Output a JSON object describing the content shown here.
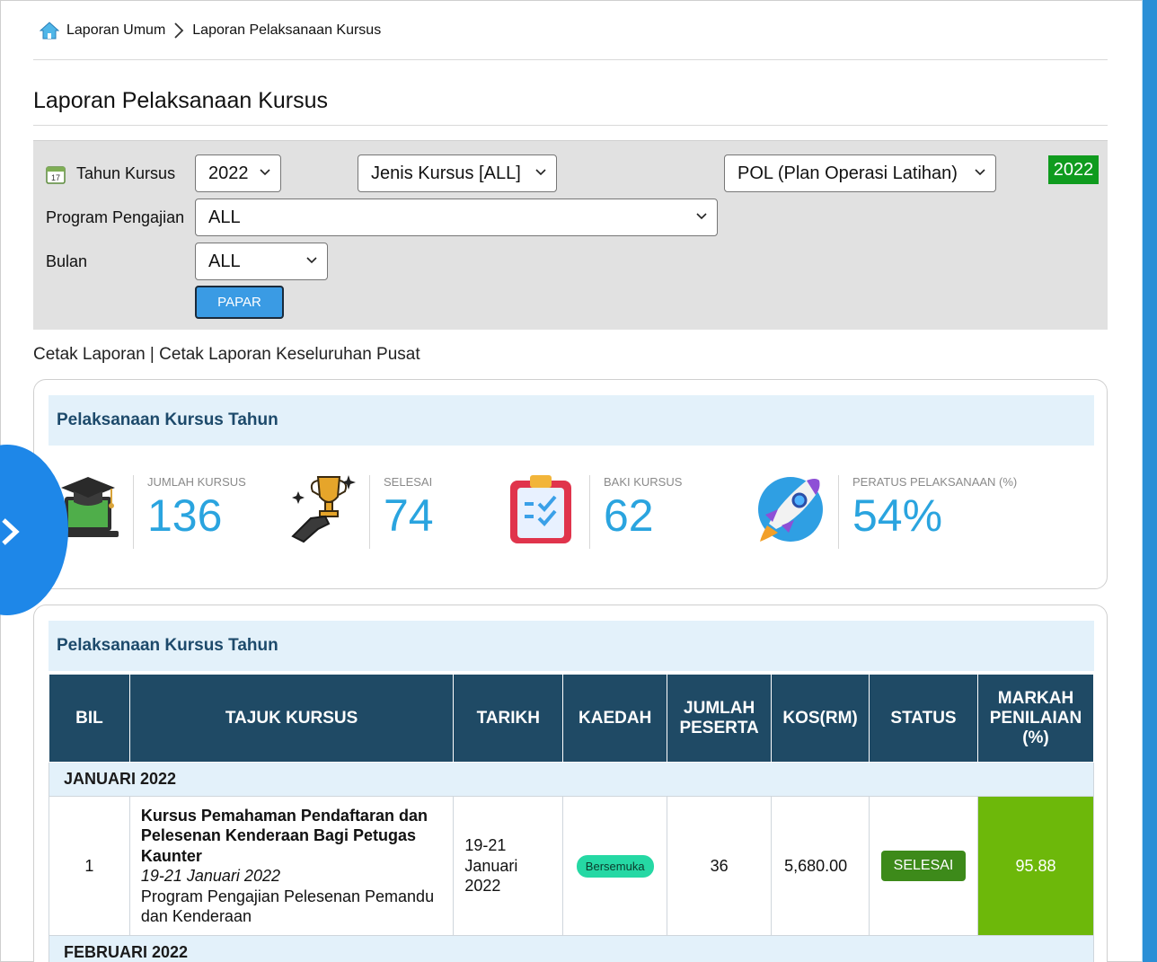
{
  "breadcrumb": {
    "home": "Laporan Umum",
    "current": "Laporan Pelaksanaan Kursus"
  },
  "page": {
    "title": "Laporan Pelaksanaan Kursus"
  },
  "filters": {
    "tahun_label": "Tahun Kursus",
    "tahun_value": "2022",
    "jenis_value": "Jenis Kursus [ALL]",
    "pol_value": "POL (Plan Operasi Latihan)",
    "year_badge": "2022",
    "program_label": "Program Pengajian",
    "program_value": "ALL",
    "bulan_label": "Bulan",
    "bulan_value": "ALL",
    "papar_label": "PAPAR"
  },
  "links": {
    "cetak": "Cetak Laporan",
    "sep": " | ",
    "cetak_pusat": "Cetak Laporan Keseluruhan Pusat"
  },
  "summary": {
    "title": "Pelaksanaan Kursus Tahun",
    "stats": [
      {
        "label": "JUMLAH KURSUS",
        "value": "136",
        "icon": "graduation-laptop-icon"
      },
      {
        "label": "SELESAI",
        "value": "74",
        "icon": "trophy-icon"
      },
      {
        "label": "BAKI KURSUS",
        "value": "62",
        "icon": "clipboard-icon"
      },
      {
        "label": "PERATUS PELAKSANAAN (%)",
        "value": "54%",
        "icon": "rocket-icon"
      }
    ]
  },
  "table": {
    "title": "Pelaksanaan Kursus Tahun",
    "headers": [
      "BIL",
      "TAJUK KURSUS",
      "TARIKH",
      "KAEDAH",
      "JUMLAH PESERTA",
      "KOS(RM)",
      "STATUS",
      "MARKAH PENILAIAN (%)"
    ],
    "months": [
      "JANUARI 2022",
      "FEBRUARI 2022"
    ],
    "rows": [
      {
        "bil": "1",
        "title": "Kursus Pemahaman Pendaftaran dan Pelesenan Kenderaan Bagi Petugas Kaunter",
        "date_italic": "19-21 Januari 2022",
        "program": "Program Pengajian Pelesenan Pemandu dan Kenderaan",
        "tarikh": "19-21 Januari 2022",
        "kaedah": "Bersemuka",
        "peserta": "36",
        "kos": "5,680.00",
        "status": "SELESAI",
        "markah": "95.88"
      }
    ]
  }
}
